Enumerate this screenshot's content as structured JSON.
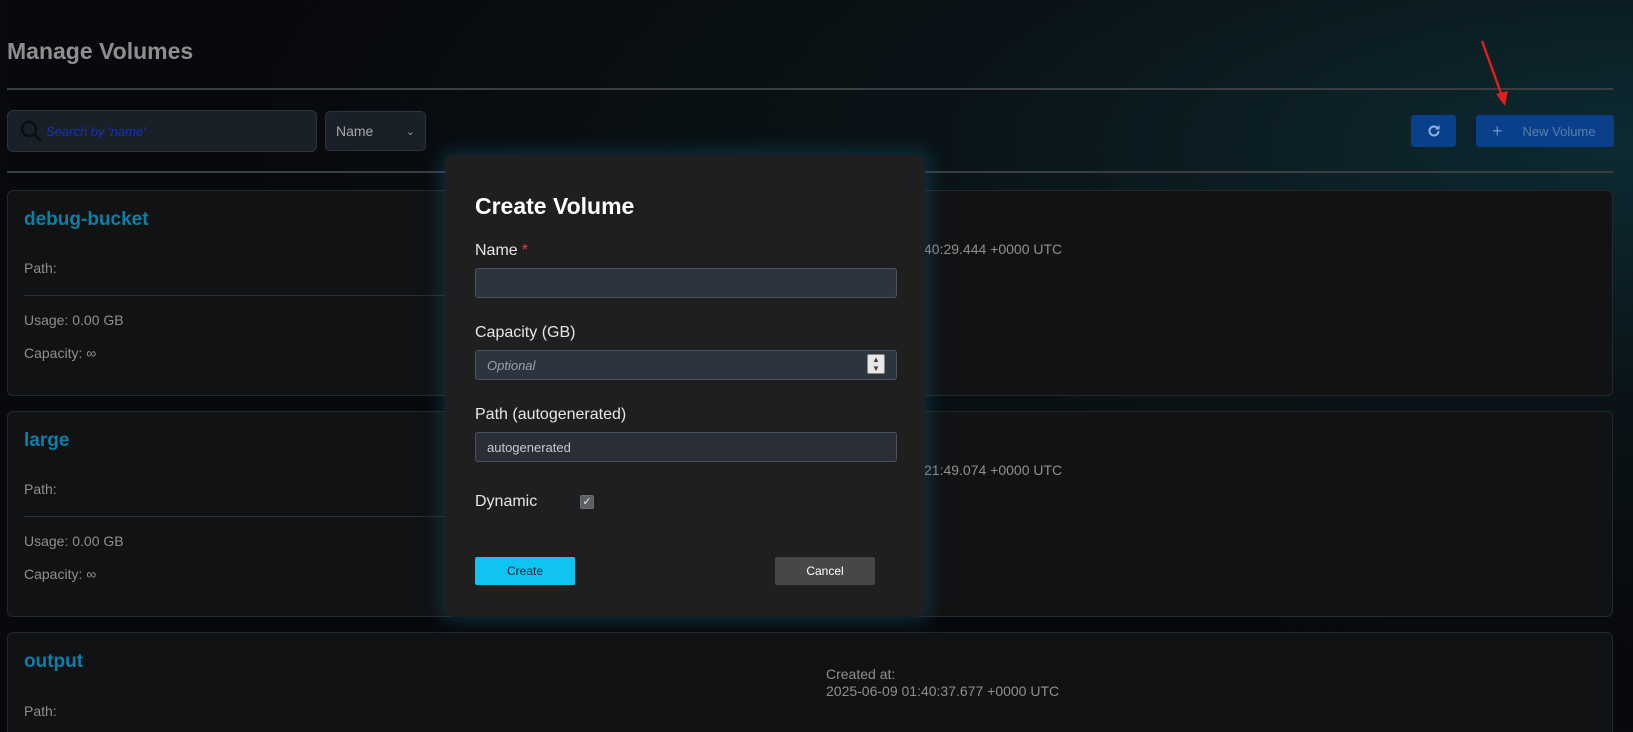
{
  "page": {
    "title": "Manage Volumes"
  },
  "toolbar": {
    "search_placeholder": "Search by 'name'",
    "sort_value": "Name",
    "refresh_icon": "refresh-icon",
    "new_volume_label": "New Volume",
    "new_volume_icon": "plus-icon"
  },
  "volumes": [
    {
      "name": "debug-bucket",
      "path_label": "Path:",
      "usage_label": "Usage: 0.00 GB",
      "capacity_label": "Capacity: ∞",
      "created_visible": "40:29.444 +0000 UTC"
    },
    {
      "name": "large",
      "path_label": "Path:",
      "usage_label": "Usage: 0.00 GB",
      "capacity_label": "Capacity: ∞",
      "created_visible": "21:49.074 +0000 UTC"
    },
    {
      "name": "output",
      "path_label": "Path:",
      "created_label": "Created at:",
      "created_value": "2025-06-09 01:40:37.677 +0000 UTC"
    }
  ],
  "modal": {
    "title": "Create Volume",
    "name_label": "Name",
    "required_mark": "*",
    "name_value": "",
    "capacity_label": "Capacity (GB)",
    "capacity_placeholder": "Optional",
    "path_label": "Path (autogenerated)",
    "path_value": "autogenerated",
    "dynamic_label": "Dynamic",
    "dynamic_checked": true,
    "create_label": "Create",
    "cancel_label": "Cancel"
  },
  "colors": {
    "accent": "#10c4f2",
    "primary_button": "#0a3f8a",
    "volume_name": "#0d7fa6",
    "annotation_arrow": "#e0201a"
  }
}
